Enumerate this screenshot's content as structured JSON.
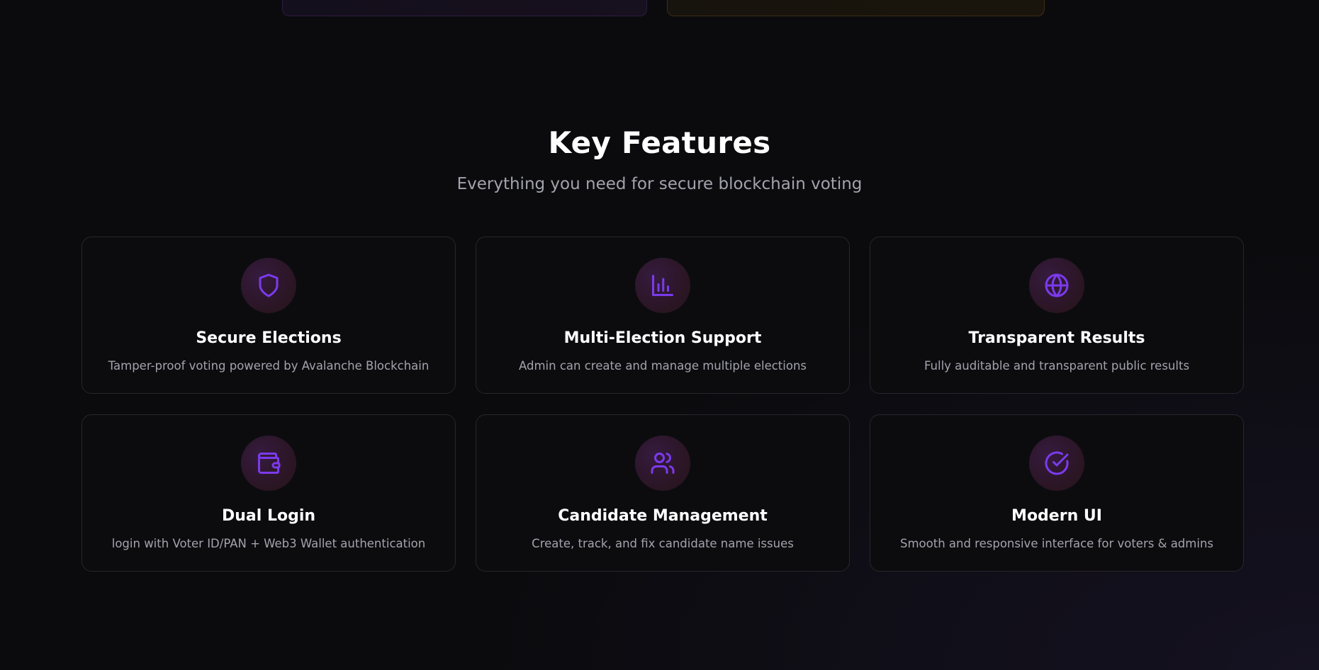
{
  "section": {
    "title": "Key Features",
    "subtitle": "Everything you need for secure blockchain voting"
  },
  "accent_color": "#7c3aed",
  "features": [
    {
      "icon": "shield-icon",
      "title": "Secure Elections",
      "description": "Tamper-proof voting powered by Avalanche Blockchain"
    },
    {
      "icon": "bar-chart-icon",
      "title": "Multi-Election Support",
      "description": "Admin can create and manage multiple elections"
    },
    {
      "icon": "globe-icon",
      "title": "Transparent Results",
      "description": "Fully auditable and transparent public results"
    },
    {
      "icon": "wallet-icon",
      "title": "Dual Login",
      "description": "login with Voter ID/PAN + Web3 Wallet authentication"
    },
    {
      "icon": "users-icon",
      "title": "Candidate Management",
      "description": "Create, track, and fix candidate name issues"
    },
    {
      "icon": "check-circle-icon",
      "title": "Modern UI",
      "description": "Smooth and responsive interface for voters & admins"
    }
  ]
}
